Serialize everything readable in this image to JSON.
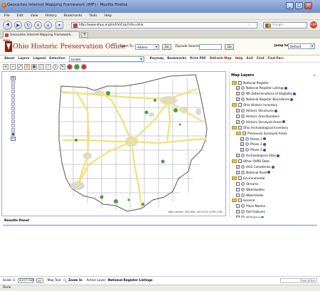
{
  "window": {
    "title": "Geocortex Internet Mapping Framework (IMF) - Mozilla Firefox"
  },
  "browser_menu": [
    "File",
    "Edit",
    "View",
    "History",
    "Bookmarks",
    "Tools",
    "Help"
  ],
  "nav": {
    "url": "http://www.ohpo.org/imf/imf.jsp?site=ohio",
    "search_placeholder": "Google"
  },
  "tab": {
    "label": "Geocortex Internet Mapping Framework..."
  },
  "header": {
    "logo_small": "OHIO",
    "logo": "Ohio Historic Preservation Office",
    "zoom_to_label": "Zoom To:",
    "zoom_to_value": "Adams",
    "go_label": "Go",
    "zipcode_label": "Zipcode Search:",
    "jump_label": "Jump to:",
    "jump_value": "Default"
  },
  "app_menu": {
    "left": [
      "About",
      "Layers",
      "Legend",
      "Selection"
    ],
    "locate": "Locate",
    "right": [
      "Keymap",
      "Bookmarks",
      "Print PDF",
      "Refresh Map",
      "Help",
      "Exit",
      "Find",
      "Find Parc"
    ]
  },
  "map": {
    "credit": "Map center: 353,606, 4471574 (UTM 17N)",
    "colors": {
      "highway": "#f2e27a",
      "county": "#9a9a9a",
      "place": "#d9d9d9",
      "feature": "#4e9a45"
    }
  },
  "layers": {
    "title": "Map Layers",
    "items": [
      {
        "label": "National Register",
        "type": "folder",
        "indent": 0
      },
      {
        "label": "National Register Listings",
        "type": "layer",
        "indent": 1,
        "checked": true
      },
      {
        "label": "NR Determinations of Eligibility",
        "type": "layer",
        "indent": 1,
        "checked": true
      },
      {
        "label": "National Register Boundaries",
        "type": "layer",
        "indent": 1,
        "checked": true
      },
      {
        "label": "Ohio Historic Inventory",
        "type": "folder",
        "indent": 0
      },
      {
        "label": "Historic Structures",
        "type": "layer",
        "indent": 1,
        "checked": true
      },
      {
        "label": "Historic Area Numbers",
        "type": "layer",
        "indent": 1,
        "checked": false
      },
      {
        "label": "Historic Surveyed Areas",
        "type": "layer",
        "indent": 1,
        "checked": true
      },
      {
        "label": "Ohio Archaeological Inventory",
        "type": "folder",
        "indent": 0
      },
      {
        "label": "Previously Surveyed Areas",
        "type": "folder",
        "indent": 1
      },
      {
        "label": "Phase 1",
        "type": "layer",
        "indent": 2,
        "checked": true
      },
      {
        "label": "Phase 2",
        "type": "layer",
        "indent": 2,
        "checked": true
      },
      {
        "label": "Phase 3",
        "type": "layer",
        "indent": 2,
        "checked": true
      },
      {
        "label": "Archaeological Sites",
        "type": "layer",
        "indent": 1,
        "checked": true
      },
      {
        "label": "Other OHPO Data",
        "type": "folder",
        "indent": 0
      },
      {
        "label": "OGS Cemeteries",
        "type": "layer",
        "indent": 1,
        "checked": true
      },
      {
        "label": "National Road",
        "type": "layer",
        "indent": 1,
        "checked": true
      },
      {
        "label": "Environmental",
        "type": "folder",
        "indent": 0
      },
      {
        "label": "Streams",
        "type": "layer",
        "indent": 1,
        "checked": false
      },
      {
        "label": "Waterbodies",
        "type": "layer",
        "indent": 1,
        "checked": false
      },
      {
        "label": "Watersheds",
        "type": "layer",
        "indent": 1,
        "checked": false
      },
      {
        "label": "General",
        "type": "folder",
        "indent": 0
      },
      {
        "label": "Place Names",
        "type": "layer",
        "indent": 1,
        "checked": false
      },
      {
        "label": "Rail Features",
        "type": "layer",
        "indent": 1,
        "checked": false
      },
      {
        "label": "Highways",
        "type": "layer",
        "indent": 1,
        "checked": true
      }
    ]
  },
  "results": {
    "title": "Results Panel"
  },
  "status": {
    "scale_label": "Scale: 1:",
    "scale_value": "3,277,520",
    "map_tool_label": "Map Tool:",
    "map_tool_value": "Zoom In",
    "active_layer_label": "Active Layer:",
    "active_layer_value": "National Register Listings",
    "powered": "Geocortex"
  },
  "browser_status": "Done"
}
